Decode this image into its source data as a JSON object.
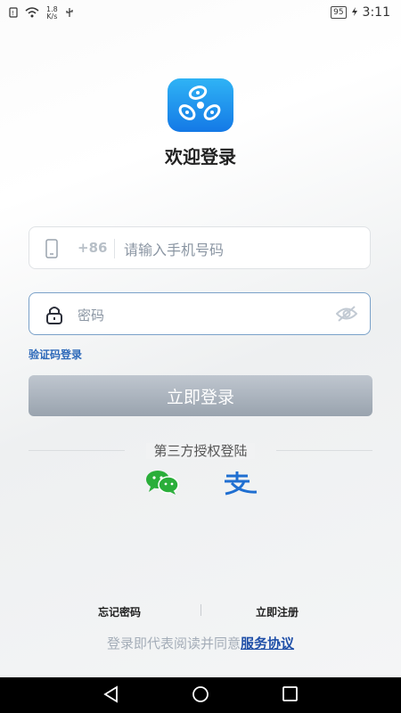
{
  "status_bar": {
    "net_speed_value": "1.8",
    "net_speed_unit": "K/s",
    "battery": "95",
    "time": "3:11"
  },
  "app": {
    "welcome_title": "欢迎登录"
  },
  "phone": {
    "prefix": "+86",
    "placeholder": "请输入手机号码"
  },
  "password": {
    "placeholder": "密码"
  },
  "links": {
    "code_login": "验证码登录",
    "forgot_password": "忘记密码",
    "register": "立即注册"
  },
  "login_button": "立即登录",
  "third_party": {
    "title": "第三方授权登陆",
    "icons": [
      "wechat-icon",
      "alipay-icon"
    ]
  },
  "agreement": {
    "prefix": "登录即代表阅读并同意",
    "link": "服务协议"
  },
  "colors": {
    "accent": "#2c68b9",
    "button": "#a7b0ba",
    "wechat": "#2aae3a",
    "alipay": "#1f6fd1"
  }
}
